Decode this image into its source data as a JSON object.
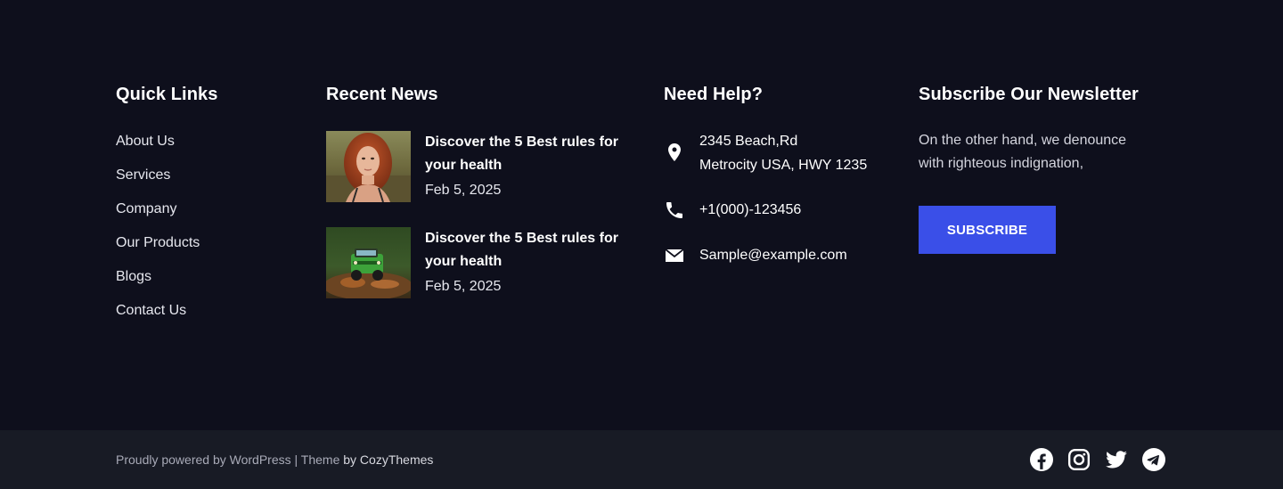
{
  "quick_links": {
    "title": "Quick Links",
    "items": [
      {
        "label": "About Us"
      },
      {
        "label": "Services"
      },
      {
        "label": "Company"
      },
      {
        "label": "Our Products"
      },
      {
        "label": "Blogs"
      },
      {
        "label": "Contact Us"
      }
    ]
  },
  "recent_news": {
    "title": "Recent News",
    "items": [
      {
        "title": "Discover the 5 Best rules for your health",
        "date": "Feb 5, 2025",
        "thumb": "portrait-woman-red-hair"
      },
      {
        "title": "Discover the 5 Best rules for your health",
        "date": "Feb 5, 2025",
        "thumb": "green-jeep-mud"
      }
    ]
  },
  "need_help": {
    "title": "Need Help?",
    "address_line1": "2345 Beach,Rd",
    "address_line2": "Metrocity USA, HWY 1235",
    "phone": "+1(000)-123456",
    "email": "Sample@example.com",
    "icons": [
      "map-pin-icon",
      "phone-icon",
      "envelope-icon"
    ]
  },
  "newsletter": {
    "title": "Subscribe Our Newsletter",
    "description": "On the other hand, we denounce with righteous indignation,",
    "button_label": "SUBSCRIBE"
  },
  "bottom_bar": {
    "powered": "Proudly powered by WordPress",
    "separator": " | ",
    "theme_prefix": "Theme ",
    "theme_by": "by CozyThemes",
    "socials": [
      "facebook-icon",
      "instagram-icon",
      "twitter-icon",
      "telegram-icon"
    ]
  },
  "colors": {
    "background": "#0e0f1c",
    "bottom_bar": "#181b25",
    "accent_button": "#3a4fe8",
    "text": "#ffffff",
    "muted": "#a8aab7"
  }
}
